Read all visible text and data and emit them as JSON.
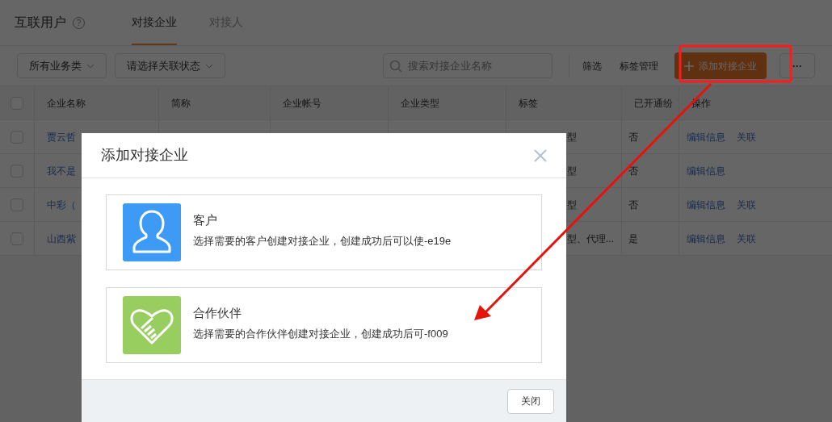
{
  "header": {
    "title": "互联用户",
    "help_icon": "?",
    "tabs": [
      {
        "label": "对接企业",
        "selected": true
      },
      {
        "label": "对接人",
        "selected": false
      }
    ]
  },
  "toolbar": {
    "dropdowns": [
      "所有业务类",
      "请选择关联状态"
    ],
    "search": {
      "placeholder": "搜索对接企业名称"
    },
    "links": [
      "筛选",
      "标签管理"
    ],
    "add_button": "添加对接企业",
    "more_button": "···"
  },
  "table": {
    "header_checked": false,
    "columns": [
      "企业名称",
      "简称",
      "企业帐号",
      "企业类型",
      "标签",
      "已开通纷",
      "操作"
    ],
    "rows": [
      {
        "checked": false,
        "name": "贾云哲",
        "tags": "型",
        "opened": "否",
        "actions": [
          "编辑信息",
          "关联"
        ]
      },
      {
        "checked": false,
        "name": "我不是",
        "tags": "型",
        "opened": "否",
        "actions": [
          "编辑信息"
        ]
      },
      {
        "checked": false,
        "name": "中彩（",
        "tags": "型",
        "opened": "否",
        "actions": [
          "编辑信息",
          "关联"
        ]
      },
      {
        "checked": false,
        "name": "山西紫",
        "tags": "型、代理...",
        "opened": "是",
        "actions": [
          "编辑信息",
          "关联"
        ]
      }
    ]
  },
  "dialog": {
    "title": "添加对接企业",
    "options": [
      {
        "kind": "customer",
        "title": "客户",
        "description": "选择需要的客户创建对接企业，创建成功后可以使-e19e"
      },
      {
        "kind": "partner",
        "title": "合作伙伴",
        "description": "选择需要的合作伙伴创建对接企业，创建成功后可-f009"
      }
    ],
    "close_button": "关闭"
  }
}
